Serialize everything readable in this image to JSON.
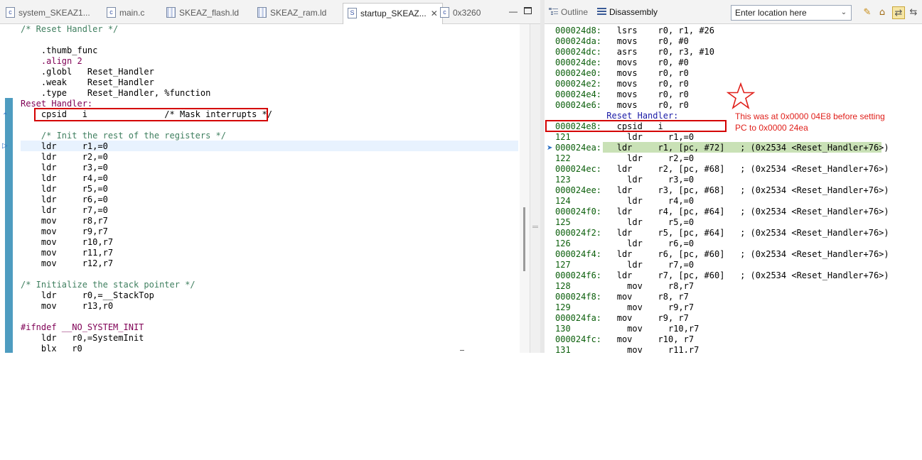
{
  "left_editor": {
    "tabs": [
      {
        "label": "system_SKEAZ1...",
        "icon": "c-file-icon"
      },
      {
        "label": "main.c",
        "icon": "c-file-icon"
      },
      {
        "label": "SKEAZ_flash.ld",
        "icon": "linker-file-icon"
      },
      {
        "label": "SKEAZ_ram.ld",
        "icon": "linker-file-icon"
      },
      {
        "label": "startup_SKEAZ...",
        "icon": "s-file-icon",
        "active": true
      },
      {
        "label": "0x3260",
        "icon": "c-file-icon"
      }
    ],
    "tab_close": "✕",
    "code_lines": [
      "/* Reset Handler */",
      "",
      "    .thumb_func",
      "    .align 2",
      "    .globl   Reset_Handler",
      "    .weak    Reset_Handler",
      "    .type    Reset_Handler, %function",
      "Reset_Handler:",
      "    cpsid   i               /* Mask interrupts */",
      "",
      "    /* Init the rest of the registers */",
      "    ldr     r1,=0",
      "    ldr     r2,=0",
      "    ldr     r3,=0",
      "    ldr     r4,=0",
      "    ldr     r5,=0",
      "    ldr     r6,=0",
      "    ldr     r7,=0",
      "    mov     r8,r7",
      "    mov     r9,r7",
      "    mov     r10,r7",
      "    mov     r11,r7",
      "    mov     r12,r7",
      "",
      "/* Initialize the stack pointer */",
      "    ldr     r0,=__StackTop",
      "    mov     r13,r0",
      "",
      "#ifndef __NO_SYSTEM_INIT",
      "    ldr   r0,=SystemInit",
      "    blx   r0"
    ]
  },
  "right_pane": {
    "tabs": [
      {
        "label": "Outline",
        "icon": "outline-icon"
      },
      {
        "label": "Disassembly",
        "icon": "disassembly-icon",
        "active": true
      }
    ],
    "location_input": {
      "value": "Enter location here"
    },
    "disassembly_lines": [
      {
        "addr": "000024d8:",
        "text": "lsrs    r0, r1, #26"
      },
      {
        "addr": "000024da:",
        "text": "movs    r0, #0"
      },
      {
        "addr": "000024dc:",
        "text": "asrs    r0, r3, #10"
      },
      {
        "addr": "000024de:",
        "text": "movs    r0, #0"
      },
      {
        "addr": "000024e0:",
        "text": "movs    r0, r0"
      },
      {
        "addr": "000024e2:",
        "text": "movs    r0, r0"
      },
      {
        "addr": "000024e4:",
        "text": "movs    r0, r0"
      },
      {
        "addr": "000024e6:",
        "text": "movs    r0, r0"
      },
      {
        "addr": "",
        "text": "          Reset_Handler:"
      },
      {
        "addr": "000024e8:",
        "text": "cpsid   i"
      },
      {
        "addr": "121",
        "text": "  ldr     r1,=0"
      },
      {
        "addr": "000024ea:",
        "text": "ldr     r1, [pc, #72]   ; (0x2534 <Reset_Handler+76>)"
      },
      {
        "addr": "122",
        "text": "  ldr     r2,=0"
      },
      {
        "addr": "000024ec:",
        "text": "ldr     r2, [pc, #68]   ; (0x2534 <Reset_Handler+76>)"
      },
      {
        "addr": "123",
        "text": "  ldr     r3,=0"
      },
      {
        "addr": "000024ee:",
        "text": "ldr     r3, [pc, #68]   ; (0x2534 <Reset_Handler+76>)"
      },
      {
        "addr": "124",
        "text": "  ldr     r4,=0"
      },
      {
        "addr": "000024f0:",
        "text": "ldr     r4, [pc, #64]   ; (0x2534 <Reset_Handler+76>)"
      },
      {
        "addr": "125",
        "text": "  ldr     r5,=0"
      },
      {
        "addr": "000024f2:",
        "text": "ldr     r5, [pc, #64]   ; (0x2534 <Reset_Handler+76>)"
      },
      {
        "addr": "126",
        "text": "  ldr     r6,=0"
      },
      {
        "addr": "000024f4:",
        "text": "ldr     r6, [pc, #60]   ; (0x2534 <Reset_Handler+76>)"
      },
      {
        "addr": "127",
        "text": "  ldr     r7,=0"
      },
      {
        "addr": "000024f6:",
        "text": "ldr     r7, [pc, #60]   ; (0x2534 <Reset_Handler+76>)"
      },
      {
        "addr": "128",
        "text": "  mov     r8,r7"
      },
      {
        "addr": "000024f8:",
        "text": "mov     r8, r7"
      },
      {
        "addr": "129",
        "text": "  mov     r9,r7"
      },
      {
        "addr": "000024fa:",
        "text": "mov     r9, r7"
      },
      {
        "addr": "130",
        "text": "  mov     r10,r7"
      },
      {
        "addr": "000024fc:",
        "text": "mov     r10, r7"
      },
      {
        "addr": "131",
        "text": "  mov     r11,r7"
      }
    ]
  },
  "annotation": {
    "note": "This was at 0x0000 04E8 before setting PC to 0x0000 24ea",
    "color": "#e0201b"
  },
  "colors": {
    "comment": "#3f7f5f",
    "keyword": "#7f0055",
    "address": "#0a5e0a",
    "pc_highlight": "#c9e1b6",
    "annotation_red": "#d40000"
  }
}
